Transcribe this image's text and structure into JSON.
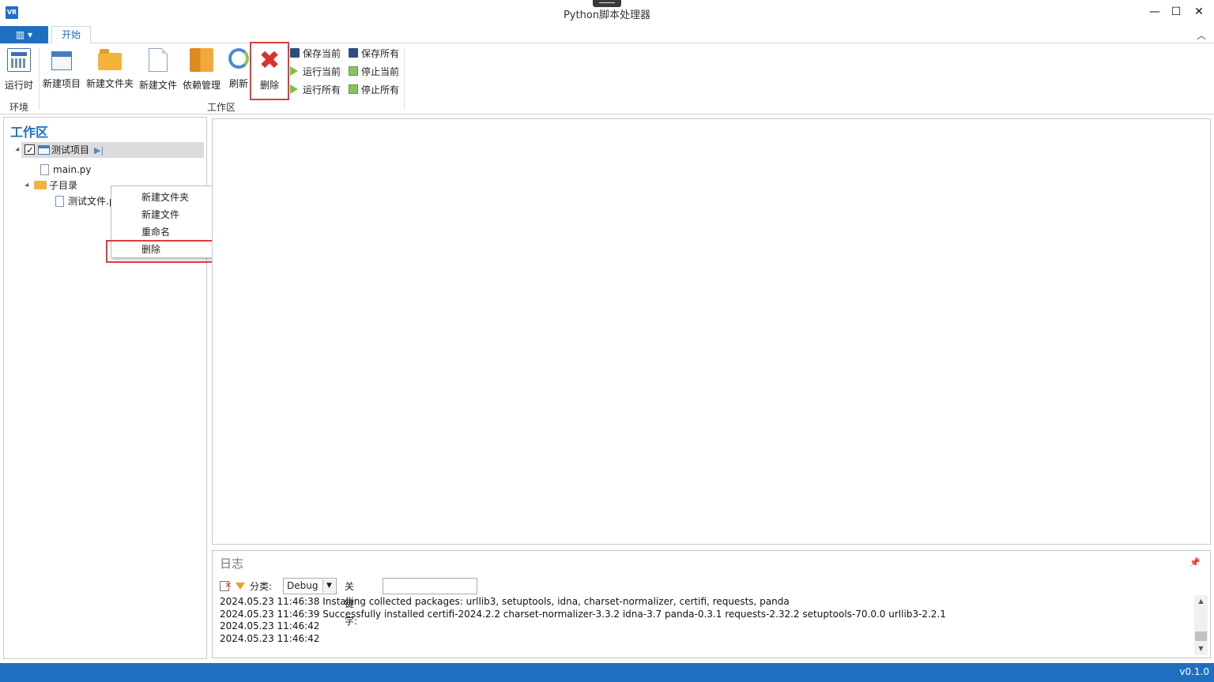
{
  "window": {
    "title": "Python脚本处理器",
    "app_icon_text": "VR",
    "minimize_glyph": "—",
    "maximize_glyph": "☐",
    "close_glyph": "✕"
  },
  "ribbon": {
    "file_menu_glyph": "▥ ▾",
    "tabs": [
      {
        "label": "开始"
      }
    ],
    "collapse_glyph": "︿",
    "groups": [
      {
        "label": "环境"
      },
      {
        "label": "工作区"
      }
    ],
    "buttons": {
      "runtime": "运行时",
      "new_project": "新建项目",
      "new_folder": "新建文件夹",
      "new_file": "新建文件",
      "dependency": "依赖管理",
      "refresh": "刷新",
      "delete": "删除",
      "delete_glyph": "✖",
      "save_current": "保存当前",
      "save_all": "保存所有",
      "run_current": "运行当前",
      "stop_current": "停止当前",
      "run_all": "运行所有",
      "stop_all": "停止所有"
    },
    "icons": [
      "calculator-icon",
      "new-project-icon",
      "folder-icon",
      "file-icon",
      "books-icon",
      "refresh-icon",
      "delete-icon",
      "save-icon",
      "save-all-icon",
      "play-icon",
      "stop-icon"
    ]
  },
  "workspace": {
    "title": "工作区",
    "tree": {
      "project": "测试项目",
      "run_all_glyph": "▶|",
      "file": "main.py",
      "folder": "子目录",
      "subfile": "测试文件.p"
    }
  },
  "context_menu": {
    "items": [
      {
        "label": "新建文件夹"
      },
      {
        "label": "新建文件"
      },
      {
        "label": "重命名"
      },
      {
        "label": "删除"
      }
    ]
  },
  "log": {
    "title": "日志",
    "pin_glyph": "📌",
    "category_label": "分类:",
    "category_value": "Debug",
    "dropdown_glyph": "▼",
    "keyword_label": "关键字:",
    "keyword_value": "",
    "lines": [
      "2024.05.23 11:46:38 Installing collected packages: urllib3, setuptools, idna, charset-normalizer, certifi, requests, panda",
      "2024.05.23 11:46:39 Successfully installed certifi-2024.2.2 charset-normalizer-3.3.2 idna-3.7 panda-0.3.1 requests-2.32.2 setuptools-70.0.0 urllib3-2.2.1",
      "2024.05.23 11:46:42",
      "2024.05.23 11:46:42"
    ],
    "scroll_up_glyph": "▲",
    "scroll_down_glyph": "▼"
  },
  "status": {
    "version": "v0.1.0"
  },
  "colors": {
    "accent": "#1f6fc1",
    "highlight": "#e03b3b"
  }
}
